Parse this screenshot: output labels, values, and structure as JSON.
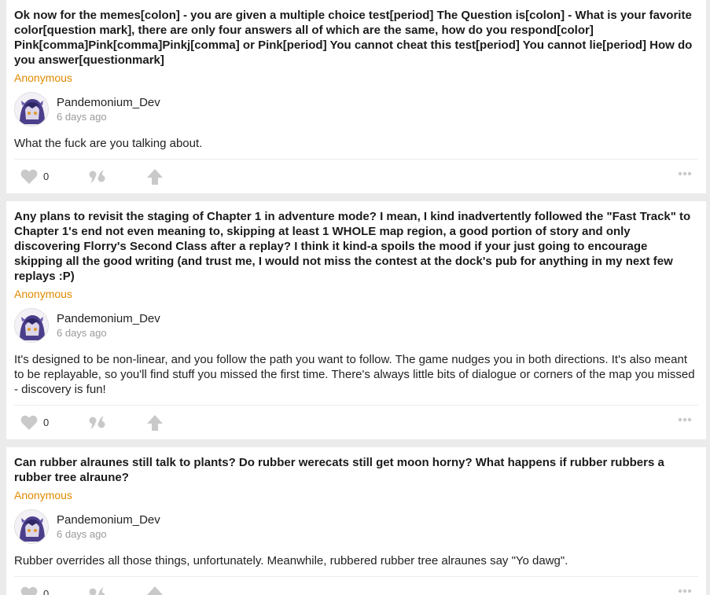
{
  "colors": {
    "background": "#ebebeb",
    "card": "#ffffff",
    "asker": "#e08a00",
    "icon": "#c9c9c9",
    "muted": "#999999"
  },
  "posts": [
    {
      "question": "Ok now for the memes[colon] - you are given a multiple choice test[period] The Question is[colon] - What is your favorite color[question mark], there are only four answers all of which are the same, how do you respond[color] Pink[comma]Pink[comma]Pinkj[comma] or Pink[period] You cannot cheat this test[period] You cannot lie[period] How do you answer[questionmark]",
      "asker": "Anonymous",
      "author": "Pandemonium_Dev",
      "time": "6 days ago",
      "answer": "What the fuck are you talking about.",
      "likes": "0"
    },
    {
      "question": "Any plans to revisit the staging of Chapter 1 in adventure mode? I mean, I kind inadvertently followed the \"Fast Track\" to Chapter 1's end not even meaning to, skipping at least 1 WHOLE map region, a good portion of story and only discovering Florry's Second Class after a replay? I think it kind-a spoils the mood if your just going to encourage skipping all the good writing (and trust me, I would not miss the contest at the dock's pub for anything in my next few replays :P)",
      "asker": "Anonymous",
      "author": "Pandemonium_Dev",
      "time": "6 days ago",
      "answer": "It's designed to be non-linear, and you follow the path you want to follow. The game nudges you in both directions. It's also meant to be replayable, so you'll find stuff you missed the first time. There's always little bits of dialogue or corners of the map you missed - discovery is fun!",
      "likes": "0"
    },
    {
      "question": "Can rubber alraunes still talk to plants? Do rubber werecats still get moon horny? What happens if rubber rubbers a rubber tree alraune?",
      "asker": "Anonymous",
      "author": "Pandemonium_Dev",
      "time": "6 days ago",
      "answer": "Rubber overrides all those things, unfortunately. Meanwhile, rubbered rubber tree alraunes say \"Yo dawg\".",
      "likes": "0"
    }
  ],
  "icons": {
    "like": "heart-icon",
    "quote": "quote-icon",
    "share": "share-up-arrow-icon",
    "more": "more-dots-icon"
  }
}
